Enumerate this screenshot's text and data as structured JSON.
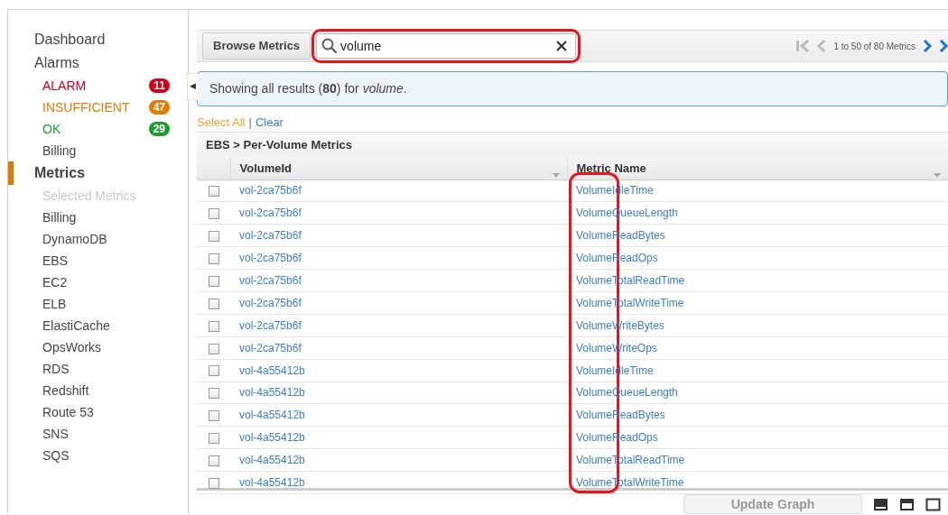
{
  "sidebar": {
    "collapse_toggle": "◀",
    "items": [
      {
        "label": "Dashboard",
        "kind": "heading",
        "selected": false
      },
      {
        "label": "Alarms",
        "kind": "heading",
        "selected": false
      },
      {
        "label": "ALARM",
        "kind": "status",
        "color": "#d0021b",
        "badge": "11",
        "selected": false
      },
      {
        "label": "INSUFFICIENT",
        "kind": "status",
        "color": "#e07b00",
        "badge": "47",
        "selected": false
      },
      {
        "label": "OK",
        "kind": "status",
        "color": "#1d9c2f",
        "badge": "29",
        "selected": false
      },
      {
        "label": "Billing",
        "kind": "sub",
        "selected": false
      },
      {
        "label": "Metrics",
        "kind": "heading",
        "selected": true
      },
      {
        "label": "Selected Metrics",
        "kind": "disabled",
        "selected": false
      },
      {
        "label": "Billing",
        "kind": "sub",
        "selected": false
      },
      {
        "label": "DynamoDB",
        "kind": "sub",
        "selected": false
      },
      {
        "label": "EBS",
        "kind": "sub",
        "selected": false
      },
      {
        "label": "EC2",
        "kind": "sub",
        "selected": false
      },
      {
        "label": "ELB",
        "kind": "sub",
        "selected": false
      },
      {
        "label": "ElastiCache",
        "kind": "sub",
        "selected": false
      },
      {
        "label": "OpsWorks",
        "kind": "sub",
        "selected": false
      },
      {
        "label": "RDS",
        "kind": "sub",
        "selected": false
      },
      {
        "label": "Redshift",
        "kind": "sub",
        "selected": false
      },
      {
        "label": "Route 53",
        "kind": "sub",
        "selected": false
      },
      {
        "label": "SNS",
        "kind": "sub",
        "selected": false
      },
      {
        "label": "SQS",
        "kind": "sub",
        "selected": false
      }
    ]
  },
  "toolbar": {
    "browse_button": "Browse Metrics",
    "search": {
      "value": "volume"
    },
    "pagination": {
      "text": "1 to 50 of 80 Metrics",
      "first_disabled": true,
      "prev_disabled": true,
      "next_disabled": false,
      "last_disabled": false
    }
  },
  "info": "Showing all results (**80**) for *volume*.",
  "select_all": "Select All",
  "separator": "|",
  "clear": "Clear",
  "group_title": "EBS > Per-Volume Metrics",
  "table": {
    "columns": [
      "VolumeId",
      "Metric Name"
    ],
    "rows": [
      {
        "volume_id": "vol-2ca75b6f",
        "metric_name": "VolumeIdleTime",
        "checked": false
      },
      {
        "volume_id": "vol-2ca75b6f",
        "metric_name": "VolumeQueueLength",
        "checked": false
      },
      {
        "volume_id": "vol-2ca75b6f",
        "metric_name": "VolumeReadBytes",
        "checked": false
      },
      {
        "volume_id": "vol-2ca75b6f",
        "metric_name": "VolumeReadOps",
        "checked": false
      },
      {
        "volume_id": "vol-2ca75b6f",
        "metric_name": "VolumeTotalReadTime",
        "checked": false
      },
      {
        "volume_id": "vol-2ca75b6f",
        "metric_name": "VolumeTotalWriteTime",
        "checked": false
      },
      {
        "volume_id": "vol-2ca75b6f",
        "metric_name": "VolumeWriteBytes",
        "checked": false
      },
      {
        "volume_id": "vol-2ca75b6f",
        "metric_name": "VolumeWriteOps",
        "checked": false
      },
      {
        "volume_id": "vol-4a55412b",
        "metric_name": "VolumeIdleTime",
        "checked": false
      },
      {
        "volume_id": "vol-4a55412b",
        "metric_name": "VolumeQueueLength",
        "checked": false
      },
      {
        "volume_id": "vol-4a55412b",
        "metric_name": "VolumeReadBytes",
        "checked": false
      },
      {
        "volume_id": "vol-4a55412b",
        "metric_name": "VolumeReadOps",
        "checked": false
      },
      {
        "volume_id": "vol-4a55412b",
        "metric_name": "VolumeTotalReadTime",
        "checked": false
      },
      {
        "volume_id": "vol-4a55412b",
        "metric_name": "VolumeTotalWriteTime",
        "checked": false
      }
    ]
  },
  "footer": {
    "update_button": {
      "label": "Update Graph",
      "disabled": true
    },
    "layouts": [
      {
        "kind": "bottom",
        "selected": false
      },
      {
        "kind": "top",
        "selected": false
      },
      {
        "kind": "full",
        "selected": false
      }
    ]
  },
  "annotations": {
    "search_ring": true,
    "column_ring": true
  }
}
